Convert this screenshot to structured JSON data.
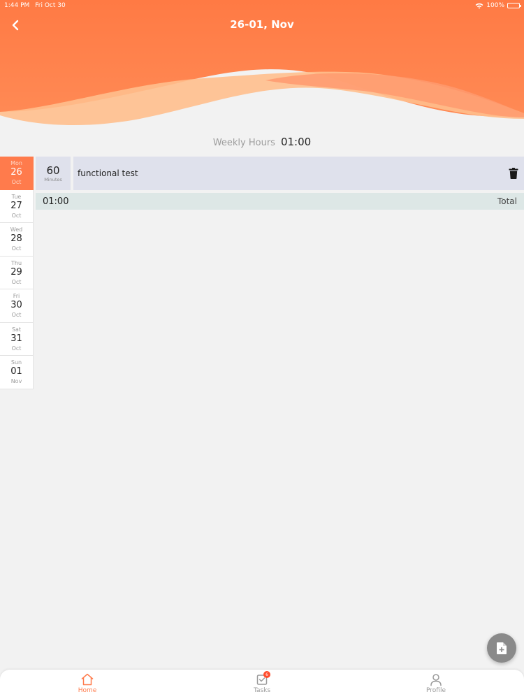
{
  "status_bar": {
    "time": "1:44 PM",
    "date": "Fri Oct 30",
    "battery": "100%"
  },
  "header": {
    "title": "26-01, Nov"
  },
  "weekly": {
    "label": "Weekly Hours",
    "value": "01:00"
  },
  "days": [
    {
      "dow": "Mon",
      "num": "26",
      "mon": "Oct",
      "active": true
    },
    {
      "dow": "Tue",
      "num": "27",
      "mon": "Oct"
    },
    {
      "dow": "Wed",
      "num": "28",
      "mon": "Oct"
    },
    {
      "dow": "Thu",
      "num": "29",
      "mon": "Oct"
    },
    {
      "dow": "Fri",
      "num": "30",
      "mon": "Oct"
    },
    {
      "dow": "Sat",
      "num": "31",
      "mon": "Oct"
    },
    {
      "dow": "Sun",
      "num": "01",
      "mon": "Nov"
    }
  ],
  "entry": {
    "minutes": "60",
    "minutes_unit": "Minutes",
    "description": "functional test"
  },
  "total": {
    "time": "01:00",
    "label": "Total"
  },
  "tabs": {
    "home": "Home",
    "tasks": "Tasks",
    "tasks_badge": "6",
    "profile": "Profile"
  },
  "colors": {
    "accent": "#ff7b4c",
    "header_top": "#ff7a44",
    "wave_light": "#ffbf8d",
    "entry_bg": "#dfe1ec",
    "total_bg": "#dde7e6"
  },
  "icons": {
    "back": "chevron-left-icon",
    "trash": "trash-icon",
    "fab": "add-document-icon",
    "home": "home-icon",
    "tasks": "tasks-icon",
    "profile": "profile-icon"
  }
}
